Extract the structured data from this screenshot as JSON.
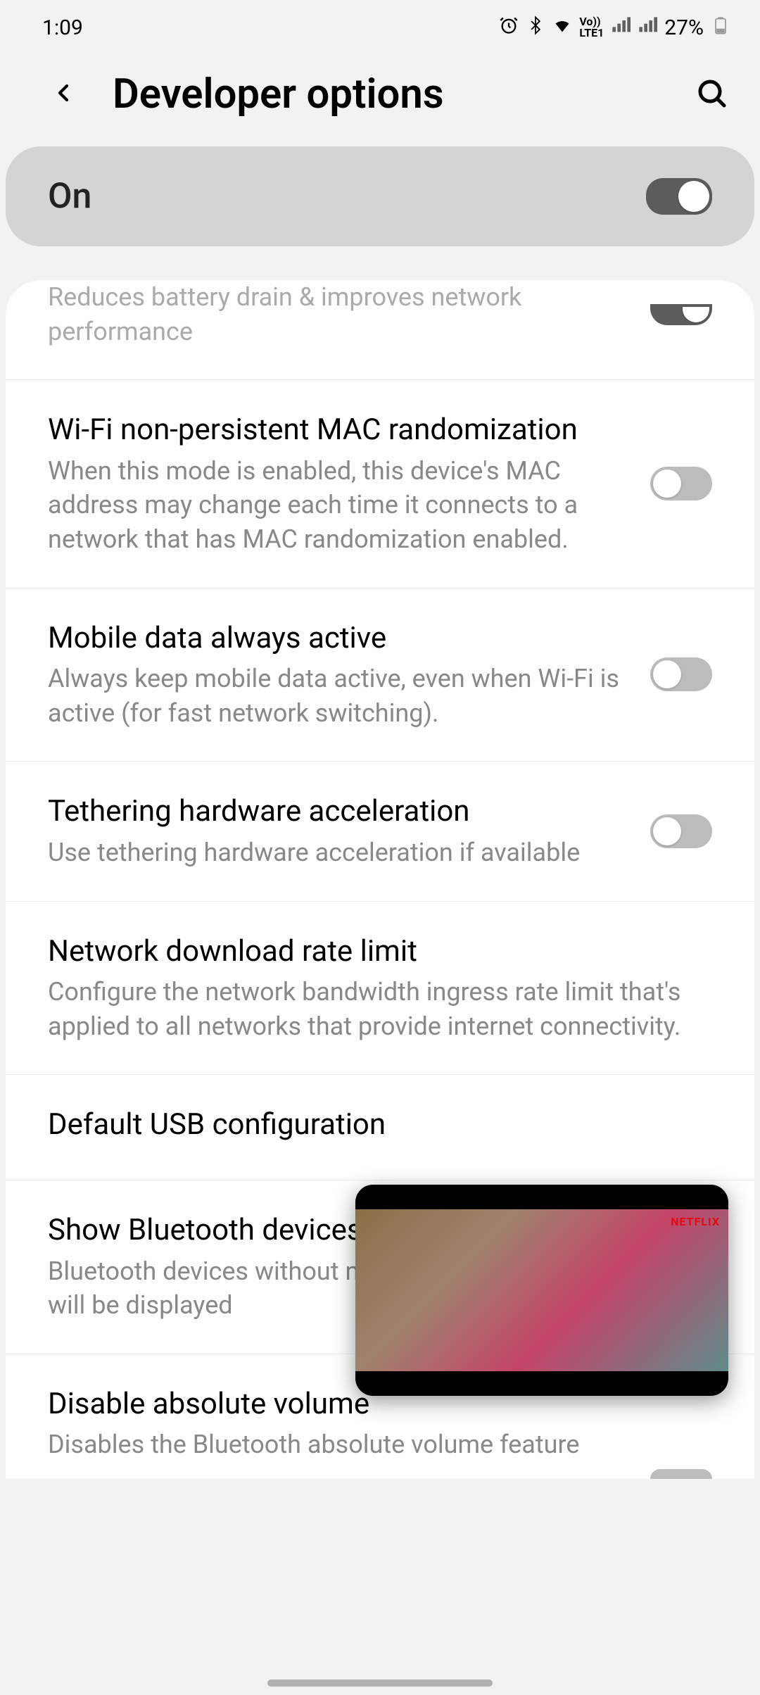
{
  "status_bar": {
    "time": "1:09",
    "battery": "27%"
  },
  "header": {
    "title": "Developer options"
  },
  "master_toggle": {
    "label": "On",
    "state": true
  },
  "settings": [
    {
      "id": "partial-top",
      "desc": "Reduces battery drain & improves network performance",
      "toggle": true,
      "partial": true
    },
    {
      "id": "wifi-mac",
      "title": "Wi-Fi non-persistent MAC randomization",
      "desc": "When this mode is enabled, this device's MAC address may change each time it connects to a network that has MAC randomization enabled.",
      "toggle": false
    },
    {
      "id": "mobile-data",
      "title": "Mobile data always active",
      "desc": "Always keep mobile data active, even when Wi-Fi is active (for fast network switching).",
      "toggle": false
    },
    {
      "id": "tethering",
      "title": "Tethering hardware acceleration",
      "desc": "Use tethering hardware acceleration if available",
      "toggle": false
    },
    {
      "id": "rate-limit",
      "title": "Network download rate limit",
      "desc": "Configure the network bandwidth ingress rate limit that's applied to all networks that provide internet connectivity.",
      "no_toggle": true
    },
    {
      "id": "usb",
      "title": "Default USB configuration",
      "no_toggle": true
    },
    {
      "id": "bluetooth-names",
      "title": "Show Bluetooth devices without names",
      "desc": "Bluetooth devices without names (MAC addresses only) will be displayed",
      "no_toggle": true
    },
    {
      "id": "absolute-volume",
      "title": "Disable absolute volume",
      "desc": "Disables the Bluetooth absolute volume feature",
      "no_toggle": true,
      "no_border": true
    }
  ],
  "pip": {
    "provider": "NETFLIX"
  }
}
